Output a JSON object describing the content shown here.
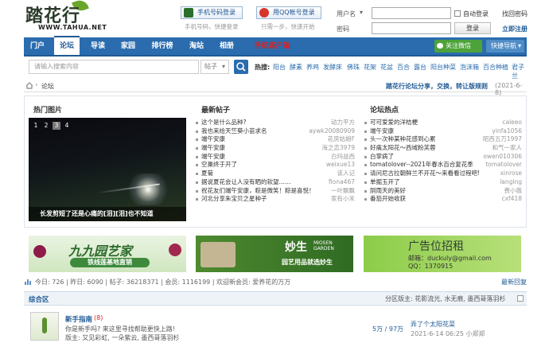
{
  "logo": {
    "name": "踏花行",
    "url": "WWW.TAHUA.NET"
  },
  "login": {
    "phone_btn": "手机号码登录",
    "phone_sub": "手机号码，快捷登录",
    "qq_btn": "用QQ帐号登录",
    "qq_sub": "只需一步，快速开始",
    "user_label": "用户名",
    "pass_label": "密码",
    "auto_login": "自动登录",
    "find_pass": "找回密码",
    "login_btn": "登录",
    "register": "立即注册"
  },
  "nav": {
    "items": [
      "门户",
      "论坛",
      "导读",
      "家园",
      "排行榜",
      "淘站",
      "相册",
      "手机客户端"
    ],
    "wechat": "关注微信",
    "quick": "快捷导航"
  },
  "search": {
    "placeholder": "请输入搜索内容",
    "scope": "帖子",
    "hot_label": "热搜:",
    "hot": [
      "阳台",
      "酵素",
      "养鸡",
      "发酵床",
      "佛珠",
      "花架",
      "花盆",
      "百合",
      "露台",
      "阳台种菜",
      "泡沫箱",
      "百合种植",
      "君子兰"
    ]
  },
  "breadcrumb": {
    "label": "论坛",
    "notice": "踏花行论坛分享，交换，转让版规则",
    "date": "(2021-6-8)"
  },
  "hot_pics": {
    "title": "热门图片",
    "pages": [
      "1",
      "2",
      "3",
      "4"
    ],
    "active": "3",
    "caption": "长发剪短了还是心痛的[泪][泪]也不知道"
  },
  "new_posts": {
    "title": "最新帖子",
    "rows": [
      {
        "t": "这个是什么品种?",
        "a": "动力平方"
      },
      {
        "t": "我也来给天竺葵小苗求名",
        "a": "aywk20080909"
      },
      {
        "t": "端午安康",
        "a": "花房姑娘F"
      },
      {
        "t": "端午安康",
        "a": "海之恋3979"
      },
      {
        "t": "端午安康",
        "a": "白玛益西"
      },
      {
        "t": "空巢终于开了",
        "a": "weixue13"
      },
      {
        "t": "夏菊",
        "a": "该人记"
      },
      {
        "t": "据说夏花会让人没有晒的软望……",
        "a": "fiona467"
      },
      {
        "t": "祝花友们端午安康，粽是微笑！粽是喜悦！",
        "a": "一叶飘飘"
      },
      {
        "t": "河北分享朱宝贝之星种子",
        "a": "家有小禾"
      }
    ]
  },
  "forum_hot": {
    "title": "论坛热点",
    "rows": [
      {
        "t": "可可爱爱的洋桔梗",
        "a": "caleeo"
      },
      {
        "t": "端午安康",
        "a": "yinfa1056"
      },
      {
        "t": "头一次种某种花感到心累",
        "a": "昭西五万1997"
      },
      {
        "t": "好痛太阳花～西域粉芙蓉",
        "a": "和气一家人"
      },
      {
        "t": "白掌病了",
        "a": "owen010306"
      },
      {
        "t": "tomatolover--2021年春水百合复花季",
        "a": "tomatolover"
      },
      {
        "t": "请问尼古拉朝鲜兰不开花～来看看过程吧!",
        "a": "xinrose"
      },
      {
        "t": "单掘玉开了",
        "a": "langing"
      },
      {
        "t": "阴雨天的美好",
        "a": "费小薇"
      },
      {
        "t": "番茄开始收获",
        "a": "cxf418"
      }
    ]
  },
  "banners": {
    "b1_title": "九九园艺家",
    "b1_sub": "铁线莲基地直销",
    "b2_title": "妙生",
    "b2_en": "MIOSEN GARDEN",
    "b2_sub": "园艺用品就选妙生",
    "b3_title": "广告位招租",
    "b3_mail": "邮箱：duckuly@gmail.com",
    "b3_qq": "QQ：1370915"
  },
  "stats": {
    "text": "今日: 726 | 昨日: 6090 | 帖子: 36218371 | 会员: 1116199 | 欢迎新会员: 爱养花的万万",
    "latest": "最新回复"
  },
  "zone": {
    "title": "综合区",
    "mods_label": "分区版主: 花影流光, 水无痕, 墨西哥落羽杉"
  },
  "forum": {
    "name": "新手指南",
    "count": "(8)",
    "desc": "你是新手吗? 来这里寻找帮助更快上路!",
    "mods": "版主: 又见彩虹, 一朵紫云, 墨西哥落羽杉",
    "counts": "5万 / 97万",
    "last_title": "弄了个太阳花菜",
    "last_time": "2021-6-14 06:25 小郑郑"
  },
  "colors": {
    "nav": "#2a6cae",
    "link": "#1f5a94",
    "hot": "#e02020",
    "wechat": "#4da33a"
  }
}
